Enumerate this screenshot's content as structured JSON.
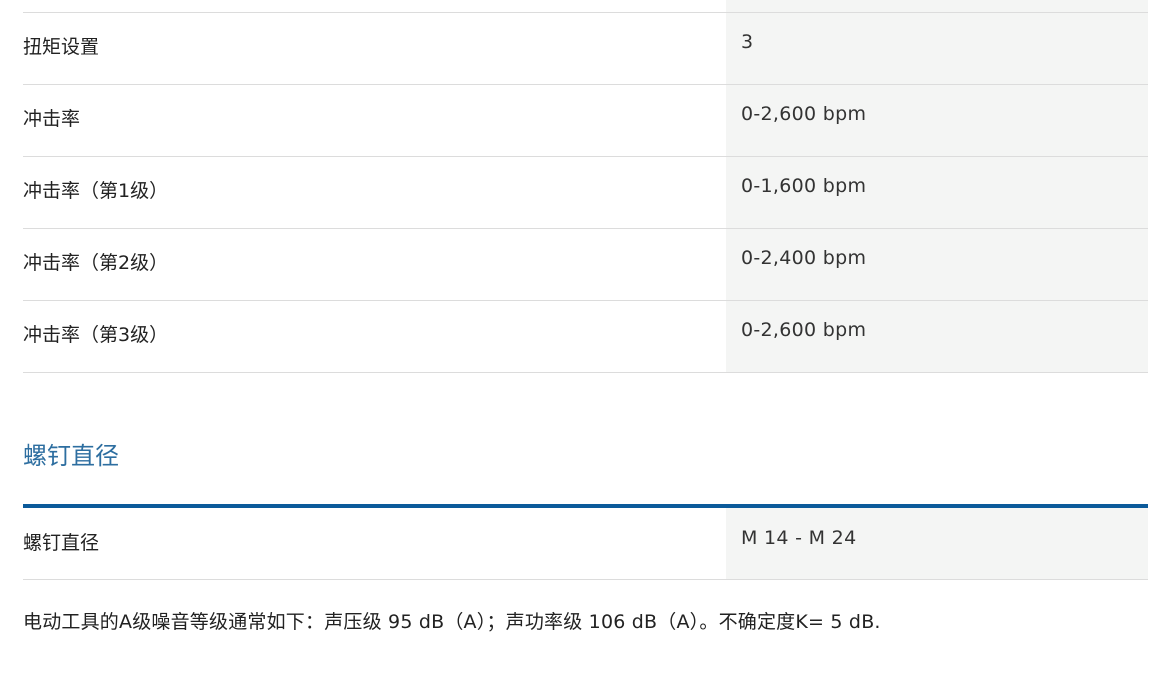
{
  "spec_table": {
    "rows": [
      {
        "label": "扭矩设置",
        "value": "3"
      },
      {
        "label": "冲击率",
        "value": "0-2,600 bpm"
      },
      {
        "label": "冲击率（第1级）",
        "value": "0-1,600 bpm"
      },
      {
        "label": "冲击率（第2级）",
        "value": "0-2,400 bpm"
      },
      {
        "label": "冲击率（第3级）",
        "value": "0-2,600 bpm"
      }
    ]
  },
  "screw_section": {
    "title": "螺钉直径",
    "rows": [
      {
        "label": "螺钉直径",
        "value": "M 14 - M 24"
      }
    ]
  },
  "noise_note": "电动工具的A级噪音等级通常如下：声压级 95 dB（A）；声功率级 106 dB（A）。不确定度K= 5 dB.",
  "colors": {
    "section_title": "#2d6ea0",
    "section_bar": "#0b5a9a",
    "value_cell_bg": "#f4f5f4",
    "row_divider": "#dcdcdc"
  }
}
